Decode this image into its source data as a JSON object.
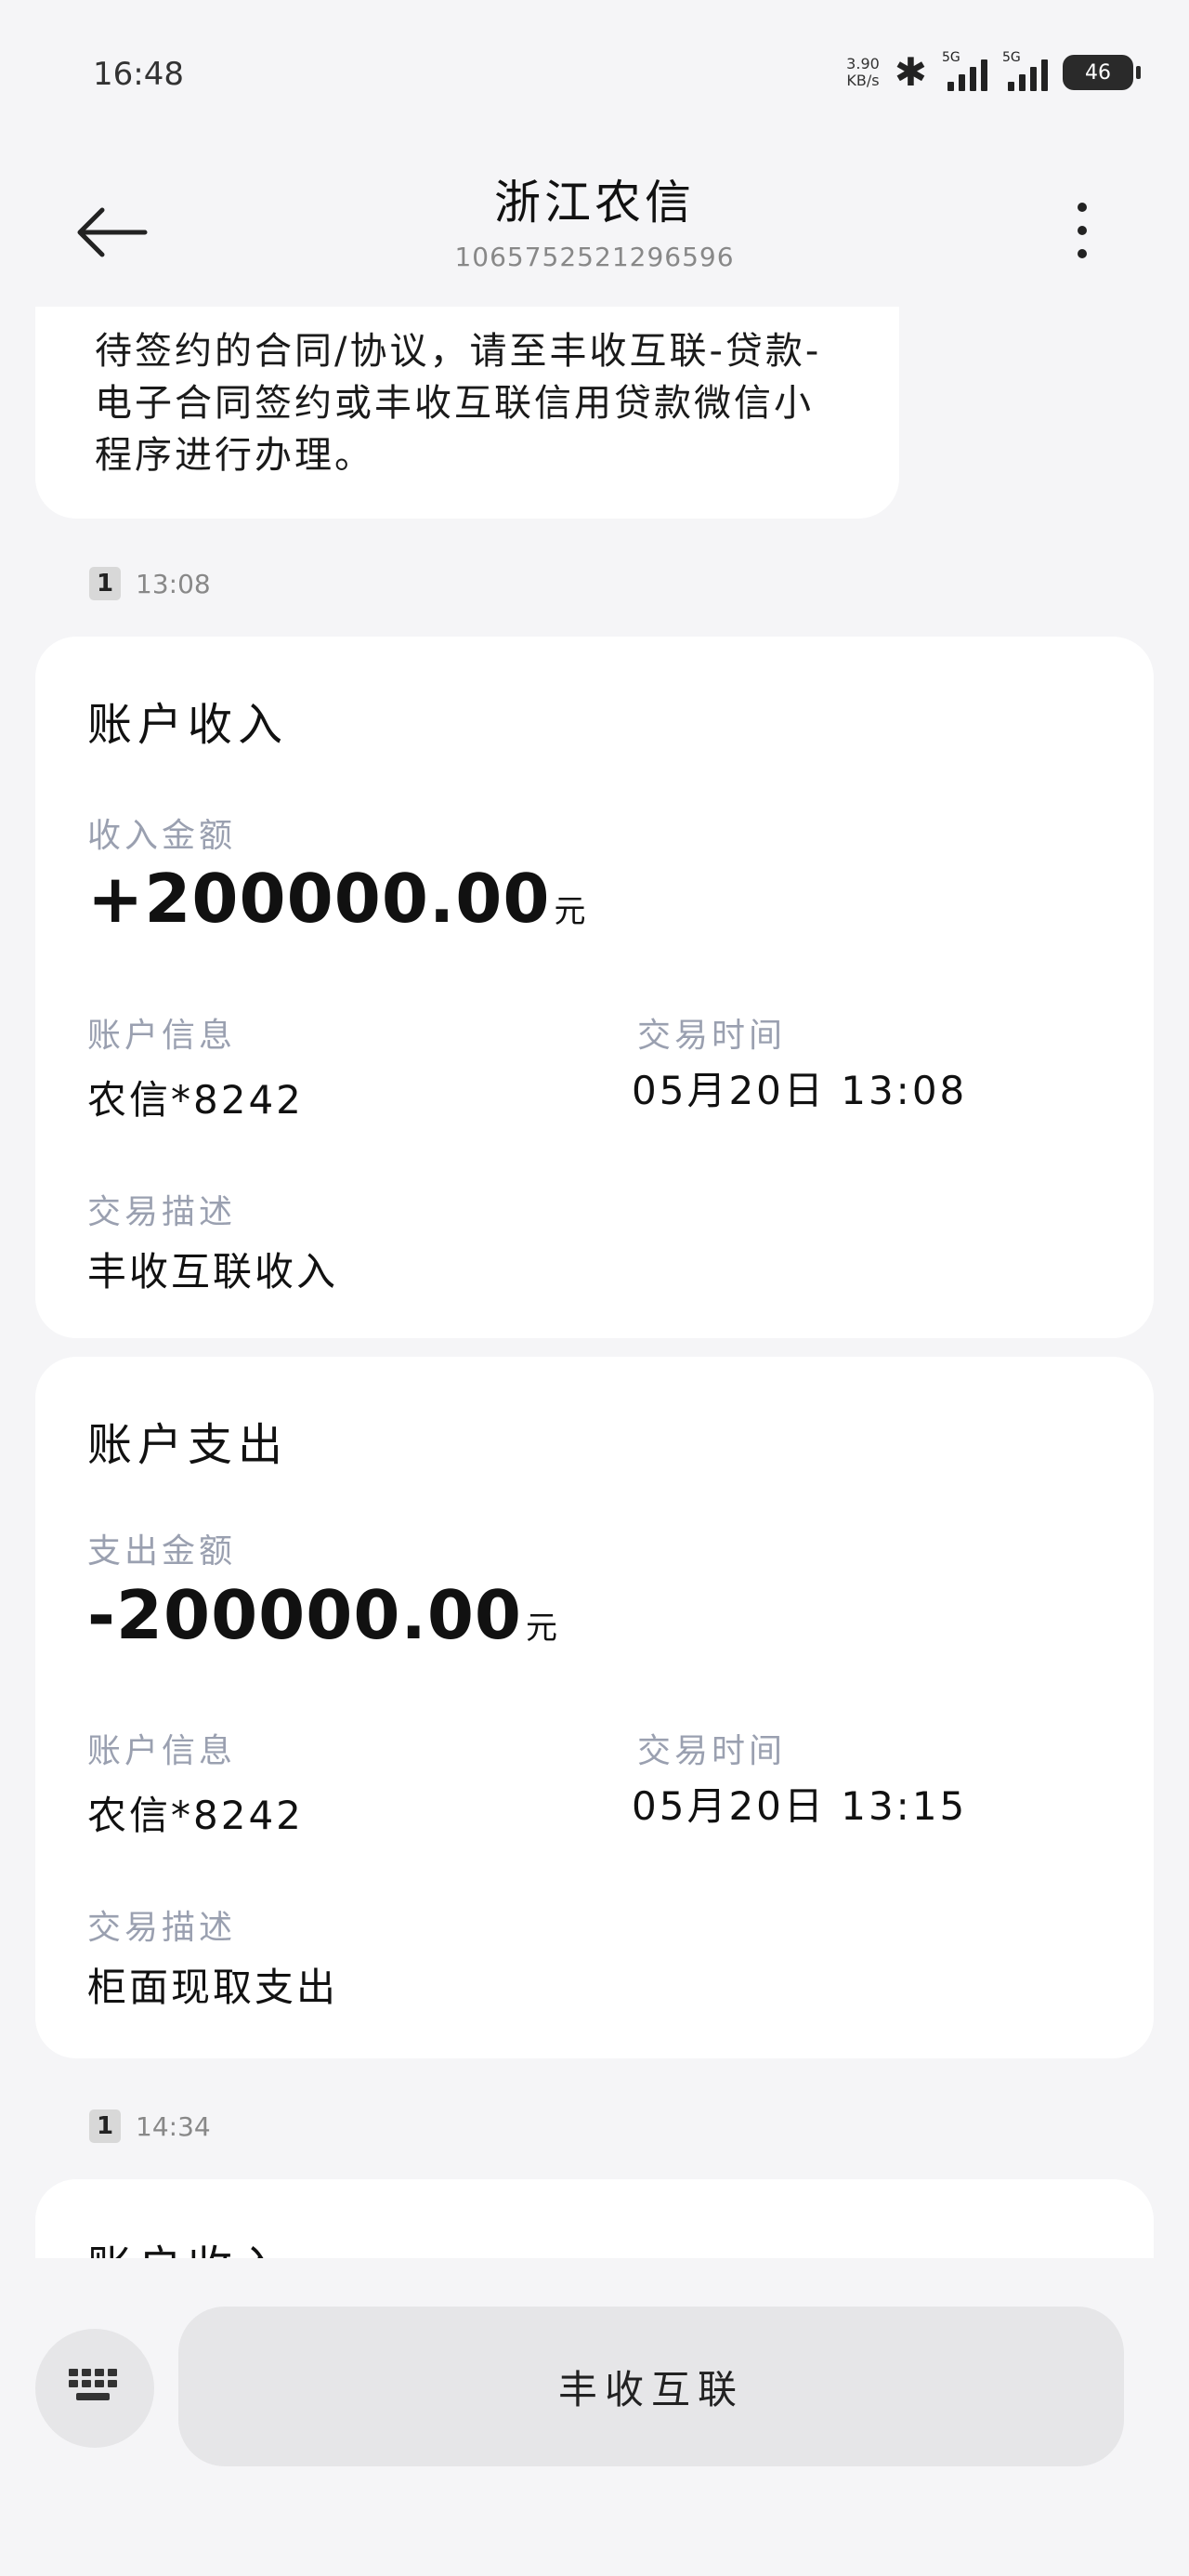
{
  "status": {
    "time": "16:48",
    "speed_value": "3.90",
    "speed_unit": "KB/s",
    "sim1_tag": "5G",
    "sim2_tag": "5G",
    "battery": "46"
  },
  "header": {
    "title": "浙江农信",
    "number": "1065752521296596"
  },
  "previous_message": {
    "text": "待签约的合同/协议，请至丰收互联-贷款-电子合同签约或丰收互联信用贷款微信小程序进行办理。"
  },
  "groups": [
    {
      "sim": "1",
      "time": "13:08"
    },
    {
      "sim": "1",
      "time": "14:34"
    }
  ],
  "cards": [
    {
      "title": "账户收入",
      "amount_label": "收入金额",
      "amount": "+200000.00",
      "unit": "元",
      "account_label": "账户信息",
      "account": "农信*8242",
      "time_label": "交易时间",
      "time": "05月20日 13:08",
      "desc_label": "交易描述",
      "desc": "丰收互联收入"
    },
    {
      "title": "账户支出",
      "amount_label": "支出金额",
      "amount": "-200000.00",
      "unit": "元",
      "account_label": "账户信息",
      "account": "农信*8242",
      "time_label": "交易时间",
      "time": "05月20日 13:15",
      "desc_label": "交易描述",
      "desc": "柜面现取支出"
    },
    {
      "title": "账户收入"
    }
  ],
  "bottom": {
    "keyboard_icon": "keyboard-icon",
    "menu_label": "丰收互联"
  }
}
